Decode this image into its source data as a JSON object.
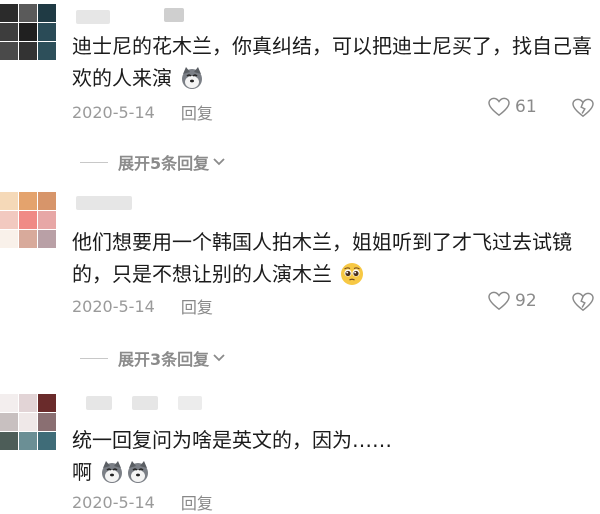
{
  "comments": [
    {
      "text": "迪士尼的花木兰，你真纠结，可以把迪士尼买了，找自己喜欢的人来演",
      "emojis": [
        "husky-emoji"
      ],
      "date": "2020-5-14",
      "reply_label": "回复",
      "likes": "61",
      "expand": "展开5条回复",
      "avatar_colors": [
        "#2b2b2b",
        "#5a5a5a",
        "#1f3a44",
        "#3d3d3d",
        "#202020",
        "#2a4b57",
        "#4a4a4a",
        "#333333",
        "#2d4f5a"
      ]
    },
    {
      "text": "他们想要用一个韩国人拍木兰，姐姐听到了才飞过去试镜的，只是不想让别的人演木兰",
      "emojis": [
        "pleading-emoji"
      ],
      "date": "2020-5-14",
      "reply_label": "回复",
      "likes": "92",
      "expand": "展开3条回复",
      "avatar_colors": [
        "#f5d9b8",
        "#e4a36d",
        "#d7956a",
        "#f2c9c0",
        "#f08a86",
        "#e7a7a6",
        "#f9f1ea",
        "#d8aa9b",
        "#b9a0a6"
      ]
    },
    {
      "text": "统一回复问为啥是英文的，因为……",
      "text2": "啊",
      "emojis": [
        "husky-emoji",
        "husky-emoji"
      ],
      "date": "2020-5-14",
      "reply_label": "回复",
      "avatar_colors": [
        "#f3eeee",
        "#e2d4d6",
        "#6a2b2b",
        "#c8c0c0",
        "#efe8e8",
        "#8a6f72",
        "#4d5d58",
        "#6b8f95",
        "#3f6c78"
      ]
    }
  ],
  "icons": [
    "heart-icon",
    "dislike-icon",
    "chevron-down-icon"
  ]
}
